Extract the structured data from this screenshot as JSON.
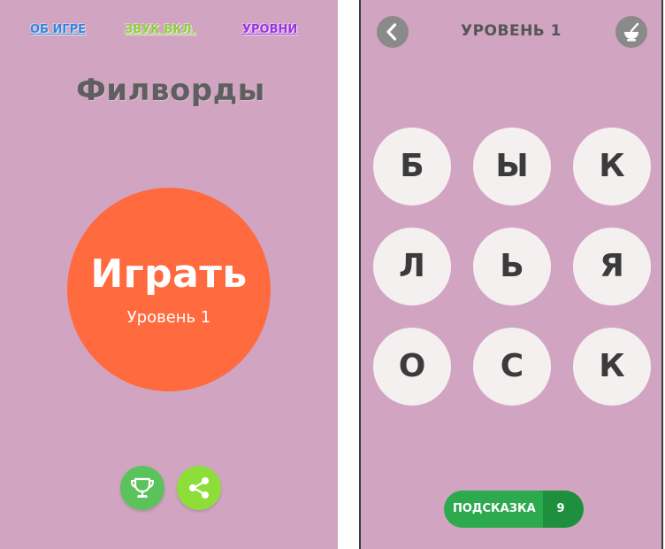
{
  "left_screen": {
    "top_links": {
      "about": "ОБ ИГРЕ",
      "sound": "ЗВУК ВКЛ.",
      "levels": "УРОВНИ"
    },
    "app_title": "Филворды",
    "play_button": {
      "label": "Играть",
      "level": "Уровень 1"
    },
    "bottom_buttons": [
      {
        "icon": "trophy-icon",
        "color": "#5cc35c"
      },
      {
        "icon": "share-icon",
        "color": "#8ede3a"
      }
    ]
  },
  "right_screen": {
    "header": {
      "back_icon": "chevron-left-icon",
      "title": "УРОВЕНЬ 1",
      "menu_icon": "mortar-bowl-icon"
    },
    "letters": [
      "Б",
      "Ы",
      "К",
      "Л",
      "Ь",
      "Я",
      "О",
      "С",
      "К"
    ],
    "hint_button": {
      "label": "ПОДСКАЗКА",
      "count": "9"
    }
  },
  "colors": {
    "background": "#d1a5c1",
    "play_circle": "#ff6a3e",
    "letter_tile": "#f5f0f0",
    "hint_green": "#2da94e",
    "link_about": "#2e86e0",
    "link_sound": "#8fd03a",
    "link_levels": "#9b31e8"
  }
}
